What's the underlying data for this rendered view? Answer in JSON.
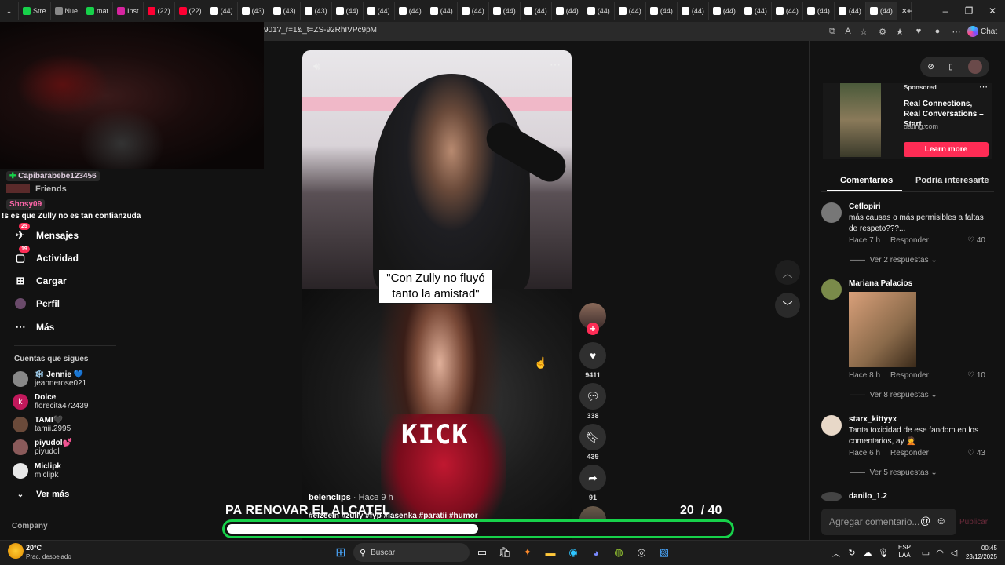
{
  "browser": {
    "tabs": [
      {
        "label": "Stre",
        "color": "#17d14a"
      },
      {
        "label": "Nue",
        "color": "#888888"
      },
      {
        "label": "mat",
        "color": "#17d14a"
      },
      {
        "label": "Inst",
        "color": "#d6249f"
      },
      {
        "label": "(22)",
        "color": "#ff0033"
      },
      {
        "label": "(22)",
        "color": "#ff0033"
      },
      {
        "label": "(44)",
        "color": "#ffffff"
      },
      {
        "label": "(43)",
        "color": "#ffffff"
      },
      {
        "label": "(43)",
        "color": "#ffffff"
      },
      {
        "label": "(43)",
        "color": "#ffffff"
      },
      {
        "label": "(44)",
        "color": "#ffffff"
      },
      {
        "label": "(44)",
        "color": "#ffffff"
      },
      {
        "label": "(44)",
        "color": "#ffffff"
      },
      {
        "label": "(44)",
        "color": "#ffffff"
      },
      {
        "label": "(44)",
        "color": "#ffffff"
      },
      {
        "label": "(44)",
        "color": "#ffffff"
      },
      {
        "label": "(44)",
        "color": "#ffffff"
      },
      {
        "label": "(44)",
        "color": "#ffffff"
      },
      {
        "label": "(44)",
        "color": "#ffffff"
      },
      {
        "label": "(44)",
        "color": "#ffffff"
      },
      {
        "label": "(44)",
        "color": "#ffffff"
      },
      {
        "label": "(44)",
        "color": "#ffffff"
      },
      {
        "label": "(44)",
        "color": "#ffffff"
      },
      {
        "label": "(44)",
        "color": "#ffffff"
      },
      {
        "label": "(44)",
        "color": "#ffffff"
      },
      {
        "label": "(44)",
        "color": "#ffffff"
      },
      {
        "label": "(44)",
        "color": "#ffffff"
      },
      {
        "label": "(44)",
        "color": "#ffffff"
      }
    ],
    "url": "901?_r=1&_t=ZS-92RhIVPc9pM",
    "chat_label": "Chat"
  },
  "chat_overlay": {
    "user1": "Capibarabebe123456",
    "friends_label": "Friends",
    "user2": "Shosy09",
    "message": "!s es que Zully no es tan confianzuda"
  },
  "sidebar": {
    "nav": [
      {
        "label": "Mensajes",
        "badge": "25"
      },
      {
        "label": "Actividad",
        "badge": "19"
      },
      {
        "label": "Cargar",
        "badge": ""
      },
      {
        "label": "Perfil",
        "badge": ""
      },
      {
        "label": "Más",
        "badge": ""
      }
    ],
    "following_title": "Cuentas que sigues",
    "following": [
      {
        "name": "❄️ Jennie 💙",
        "user": "jeannerose021",
        "color": "#888888"
      },
      {
        "name": "Dolce",
        "user": "florecita472439",
        "color": "#c2185b"
      },
      {
        "name": "TAMI🖤",
        "user": "tamii.2995",
        "color": "#6a4a3a"
      },
      {
        "name": "piyudol💕",
        "user": "piyudol",
        "color": "#8a5a5a"
      },
      {
        "name": "Miclipk",
        "user": "miclipk",
        "color": "#e8e8e8"
      }
    ],
    "see_more": "Ver más",
    "company": "Company"
  },
  "video": {
    "caption": "\"Con Zully no fluyó tanto la amistad\"",
    "watermark": "KICK",
    "author": "belenclips",
    "time": "· Hace 9 h",
    "hashtags": "#elzeein #zully #fyp #lasenka #paratii #humor",
    "likes": "9411",
    "comments": "338",
    "saves": "439",
    "shares": "91"
  },
  "ad": {
    "sponsored": "Sponsored",
    "title": "Real Connections, Real Conversations – Start...",
    "domain": "dating.com",
    "cta": "Learn more"
  },
  "comments_panel": {
    "tab_comments": "Comentarios",
    "tab_interest": "Podría interesarte",
    "reply_label": "Responder",
    "input_placeholder": "Agregar comentario...",
    "publish": "Publicar",
    "comments": [
      {
        "user": "Ceflopiri",
        "text": "más causas o más permisibles a faltas de respeto???...",
        "time": "Hace 7 h",
        "likes": "40",
        "replies": "Ver 2 respuestas"
      },
      {
        "user": "Mariana Palacios",
        "text": "",
        "time": "Hace 8 h",
        "likes": "10",
        "replies": "Ver 8 respuestas"
      },
      {
        "user": "starx_kittyyx",
        "text": "Tanta toxicidad de ese fandom en los comentarios, ay 🤦",
        "time": "Hace 6 h",
        "likes": "43",
        "replies": "Ver 5 respuestas"
      },
      {
        "user": "danilo_1.2",
        "text": "",
        "time": "",
        "likes": "",
        "replies": ""
      }
    ]
  },
  "stream_overlay": {
    "goal_text": "PA RENOVAR EL ALCATEL",
    "current": "20",
    "target": "/ 40",
    "progress": 0.5
  },
  "taskbar": {
    "weather_temp": "20°C",
    "weather_desc": "Prac. despejado",
    "search_placeholder": "Buscar",
    "lang1": "ESP",
    "lang2": "LAA",
    "clock_time": "00:45",
    "clock_date": "23/12/2025"
  }
}
